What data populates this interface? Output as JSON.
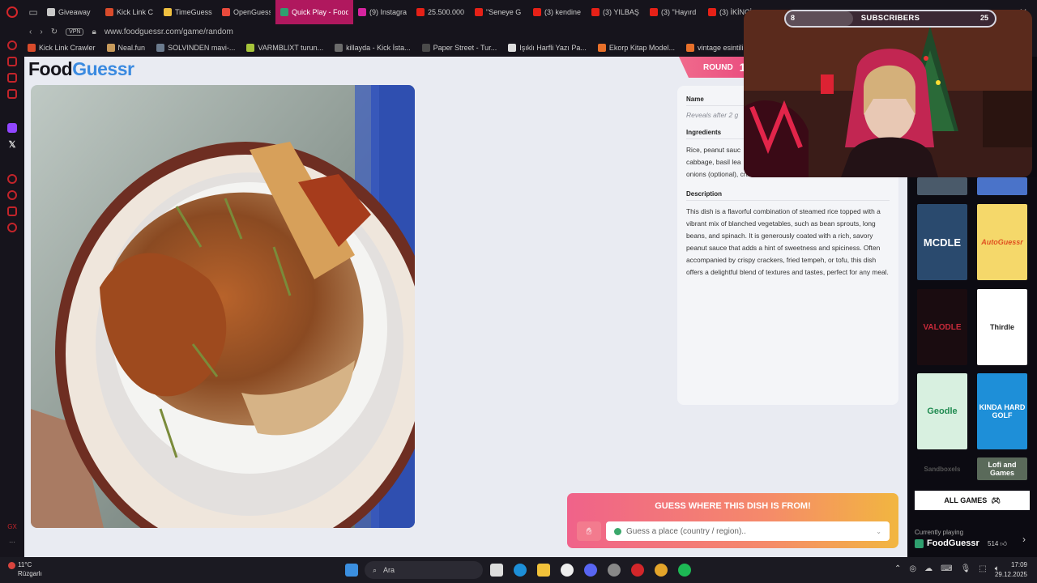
{
  "browser": {
    "tabs": [
      {
        "label": "Giveaway",
        "color": "#c9c9c9"
      },
      {
        "label": "Kick Link C",
        "color": "#d94b2b"
      },
      {
        "label": "TimeGuess",
        "color": "#f0c040"
      },
      {
        "label": "OpenGuess",
        "color": "#e84a3c"
      },
      {
        "label": "Quick Play - FoodGu",
        "color": "#2f9f6f",
        "active": true
      },
      {
        "label": "(9) Instagra",
        "color": "#d6249f"
      },
      {
        "label": "25.500.000",
        "color": "#e62117"
      },
      {
        "label": "\"Seneye G",
        "color": "#e62117"
      },
      {
        "label": "(3) kendine",
        "color": "#e62117"
      },
      {
        "label": "(3) YILBAŞ",
        "color": "#e62117"
      },
      {
        "label": "(3) \"Hayırd",
        "color": "#e62117"
      },
      {
        "label": "(3) İKİNCİ",
        "color": "#e62117"
      }
    ],
    "url": "www.foodguessr.com/game/random",
    "vpn_label": "VPN",
    "bookmarks": [
      {
        "label": "Kick Link Crawler",
        "color": "#d94b2b"
      },
      {
        "label": "Neal.fun",
        "color": "#c79a5b"
      },
      {
        "label": "SOLVINDEN mavi-...",
        "color": "#6b7b8e"
      },
      {
        "label": "VARMBLIXT turun...",
        "color": "#a6c43a"
      },
      {
        "label": "killayda - Kick İsta...",
        "color": "#6b6b6b"
      },
      {
        "label": "Paper Street - Tur...",
        "color": "#4a4a4a"
      },
      {
        "label": "Işıklı Harfli Yazı Pa...",
        "color": "#dddddd"
      },
      {
        "label": "Ekorp Kitap Model...",
        "color": "#e8702a"
      },
      {
        "label": "vintage esintili vini...",
        "color": "#e8702a"
      }
    ]
  },
  "page": {
    "logo_food": "Food",
    "logo_guessr": "Guessr",
    "round_label": "ROUND",
    "round_number": "1/",
    "name_heading": "Name",
    "name_value": "Reveals after 2 g",
    "ingredients_heading": "Ingredients",
    "ingredients_lines": [
      "Rice, peanut sauc",
      "cabbage, basil lea",
      "onions (optional), cra"
    ],
    "description_heading": "Description",
    "description_text": "This dish is a flavorful combination of steamed rice topped with a vibrant mix of blanched vegetables, such as bean sprouts, long beans, and spinach. It is generously coated with a rich, savory peanut sauce that adds a hint of sweetness and spiciness. Often accompanied by crispy crackers, fried tempeh, or tofu, this dish offers a delightful blend of textures and tastes, perfect for any meal.",
    "guess_title": "GUESS WHERE THIS DISH IS FROM!",
    "guess_placeholder": "Guess a place (country / region).."
  },
  "games_panel": {
    "cards": [
      "MCDLE",
      "AutoGuessr",
      "VALODLE",
      "Thirdle",
      "Geodle",
      "KINDA HARD GOLF",
      "Sandboxels",
      "Lofi and Games"
    ],
    "all_games_label": "ALL GAMES",
    "currently_playing_label": "Currently playing",
    "current_game": "FoodGuessr",
    "likes": "514"
  },
  "overlay": {
    "subscribers_label": "SUBSCRIBERS",
    "subscribers_current": "8",
    "subscribers_goal": "25",
    "progress": 0.32
  },
  "taskbar": {
    "temperature": "11°C",
    "weather": "Rüzgarlı",
    "search_label": "Ara",
    "time": "17:09",
    "date": "29.12.2025"
  }
}
